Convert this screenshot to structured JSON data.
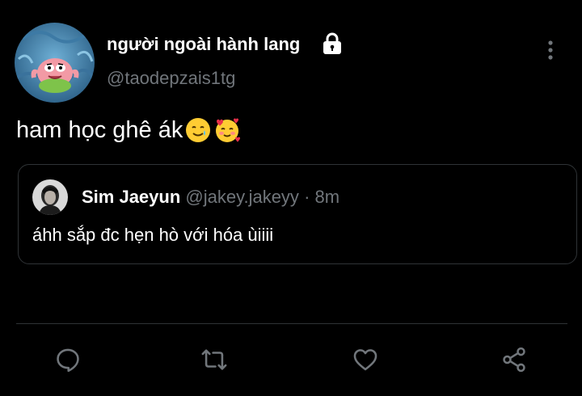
{
  "tweet": {
    "author_name": "người ngoài hành lang",
    "author_handle": "@taodepzais1tg",
    "text": "ham học ghê ák",
    "emojis": [
      "smiling-face-with-tear-emoji",
      "smiling-face-with-hearts-emoji"
    ]
  },
  "quoted_tweet": {
    "author_name": "Sim Jaeyun",
    "author_handle": "@jakey.jakeyy",
    "separator": "·",
    "time": "8m",
    "text": "áhh sắp đc hẹn hò với hóa ùiiii"
  },
  "actions": [
    "reply-icon",
    "retweet-icon",
    "like-icon",
    "share-icon"
  ],
  "colors": {
    "background": "#000000",
    "primary_text": "#ffffff",
    "secondary_text": "#71767b",
    "border": "#2f3336"
  }
}
